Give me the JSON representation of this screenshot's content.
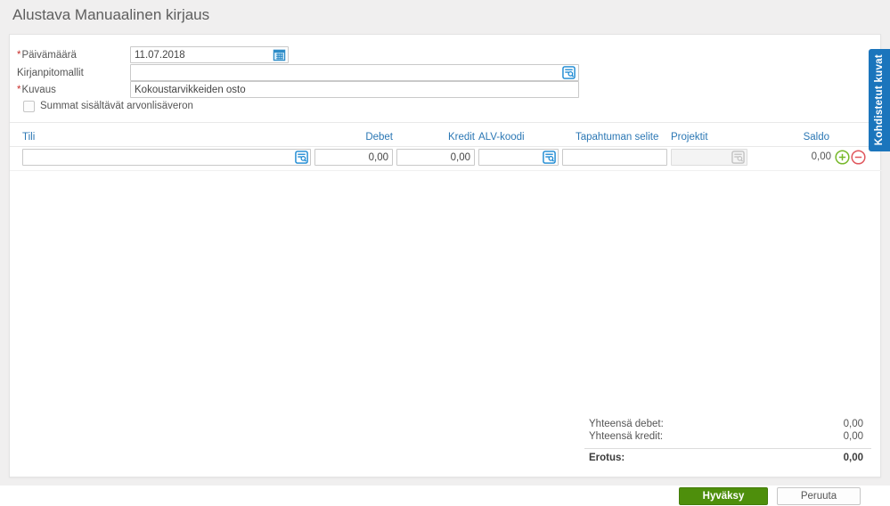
{
  "page": {
    "title": "Alustava Manuaalinen kirjaus",
    "required_marker": "*"
  },
  "form": {
    "date": {
      "label": "Päivämäärä",
      "required": true,
      "value": "11.07.2018",
      "icon": "calendar-icon"
    },
    "templates": {
      "label": "Kirjanpitomallit",
      "required": false,
      "value": "",
      "icon": "lookup-icon"
    },
    "description": {
      "label": "Kuvaus",
      "required": true,
      "value": "Kokoustarvikkeiden osto"
    },
    "vat_checkbox": {
      "label": "Summat sisältävät arvonlisäveron",
      "checked": false
    }
  },
  "side_tab": {
    "label": "Kohdistetut kuvat",
    "color": "#1b75bc"
  },
  "table": {
    "columns": {
      "tili": "Tili",
      "debet": "Debet",
      "kredit": "Kredit",
      "alv": "ALV-koodi",
      "selite": "Tapahtuman selite",
      "projektit": "Projektit",
      "saldo": "Saldo"
    },
    "row": {
      "tili": "",
      "debet": "0,00",
      "kredit": "0,00",
      "alv": "",
      "selite": "",
      "projektit": "",
      "saldo": "0,00"
    },
    "row_icons": {
      "add": "plus-circle-icon",
      "remove": "minus-circle-icon"
    },
    "accent_colors": {
      "header_blue": "#2b77b4",
      "icon_blue": "#1787d2",
      "add_green": "#76b82a",
      "remove_red": "#e0565c"
    }
  },
  "totals": {
    "debet_label": "Yhteensä debet:",
    "debet_value": "0,00",
    "kredit_label": "Yhteensä kredit:",
    "kredit_value": "0,00",
    "erotus_label": "Erotus:",
    "erotus_value": "0,00"
  },
  "footer": {
    "accept_label": "Hyväksy",
    "cancel_label": "Peruuta",
    "accept_color": "#4e8f0c"
  }
}
